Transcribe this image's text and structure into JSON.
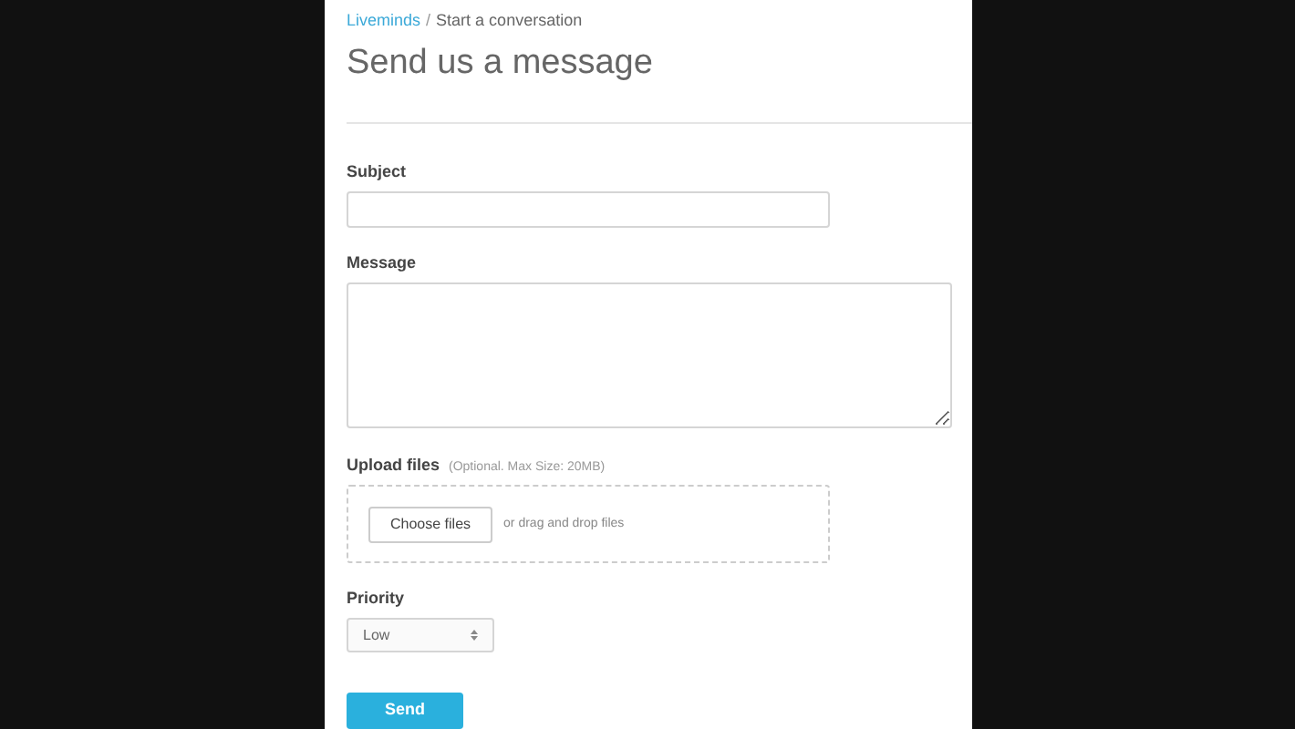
{
  "breadcrumb": {
    "link": "Liveminds",
    "separator": "/",
    "current": "Start a conversation"
  },
  "title": "Send us a message",
  "subject": {
    "label": "Subject"
  },
  "message": {
    "label": "Message"
  },
  "upload": {
    "label": "Upload files",
    "hint": "(Optional. Max Size: 20MB)",
    "button": "Choose files",
    "drop_text": "or drag and drop files"
  },
  "priority": {
    "label": "Priority",
    "value": "Low"
  },
  "send_button": "Send"
}
